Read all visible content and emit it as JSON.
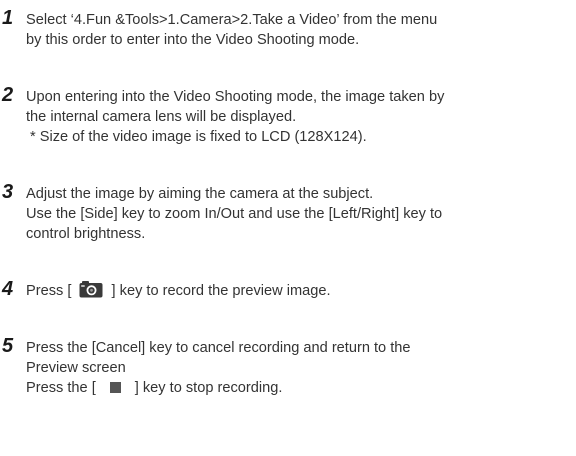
{
  "steps": [
    {
      "number": "1",
      "lines": [
        "Select ‘4.Fun &Tools>1.Camera>2.Take a Video’ from the menu",
        "by this order to enter into the Video Shooting mode."
      ]
    },
    {
      "number": "2",
      "lines": [
        "Upon entering into the Video Shooting mode, the image taken by",
        "the internal camera lens will be displayed."
      ],
      "note": "* Size of the video image is fixed to LCD (128X124)."
    },
    {
      "number": "3",
      "lines": [
        "Adjust the image by aiming the camera at the subject.",
        "Use the [Side] key to zoom In/Out and use the [Left/Right] key to",
        "control brightness."
      ]
    },
    {
      "number": "4",
      "pre": "Press [",
      "post": "] key to record the preview image.",
      "icon": "camera-key-icon"
    },
    {
      "number": "5",
      "lines": [
        "Press the [Cancel] key to cancel recording and return to the",
        "Preview screen"
      ],
      "pre": "Press the [",
      "post": "] key to stop recording.",
      "icon": "stop-key-icon"
    }
  ]
}
